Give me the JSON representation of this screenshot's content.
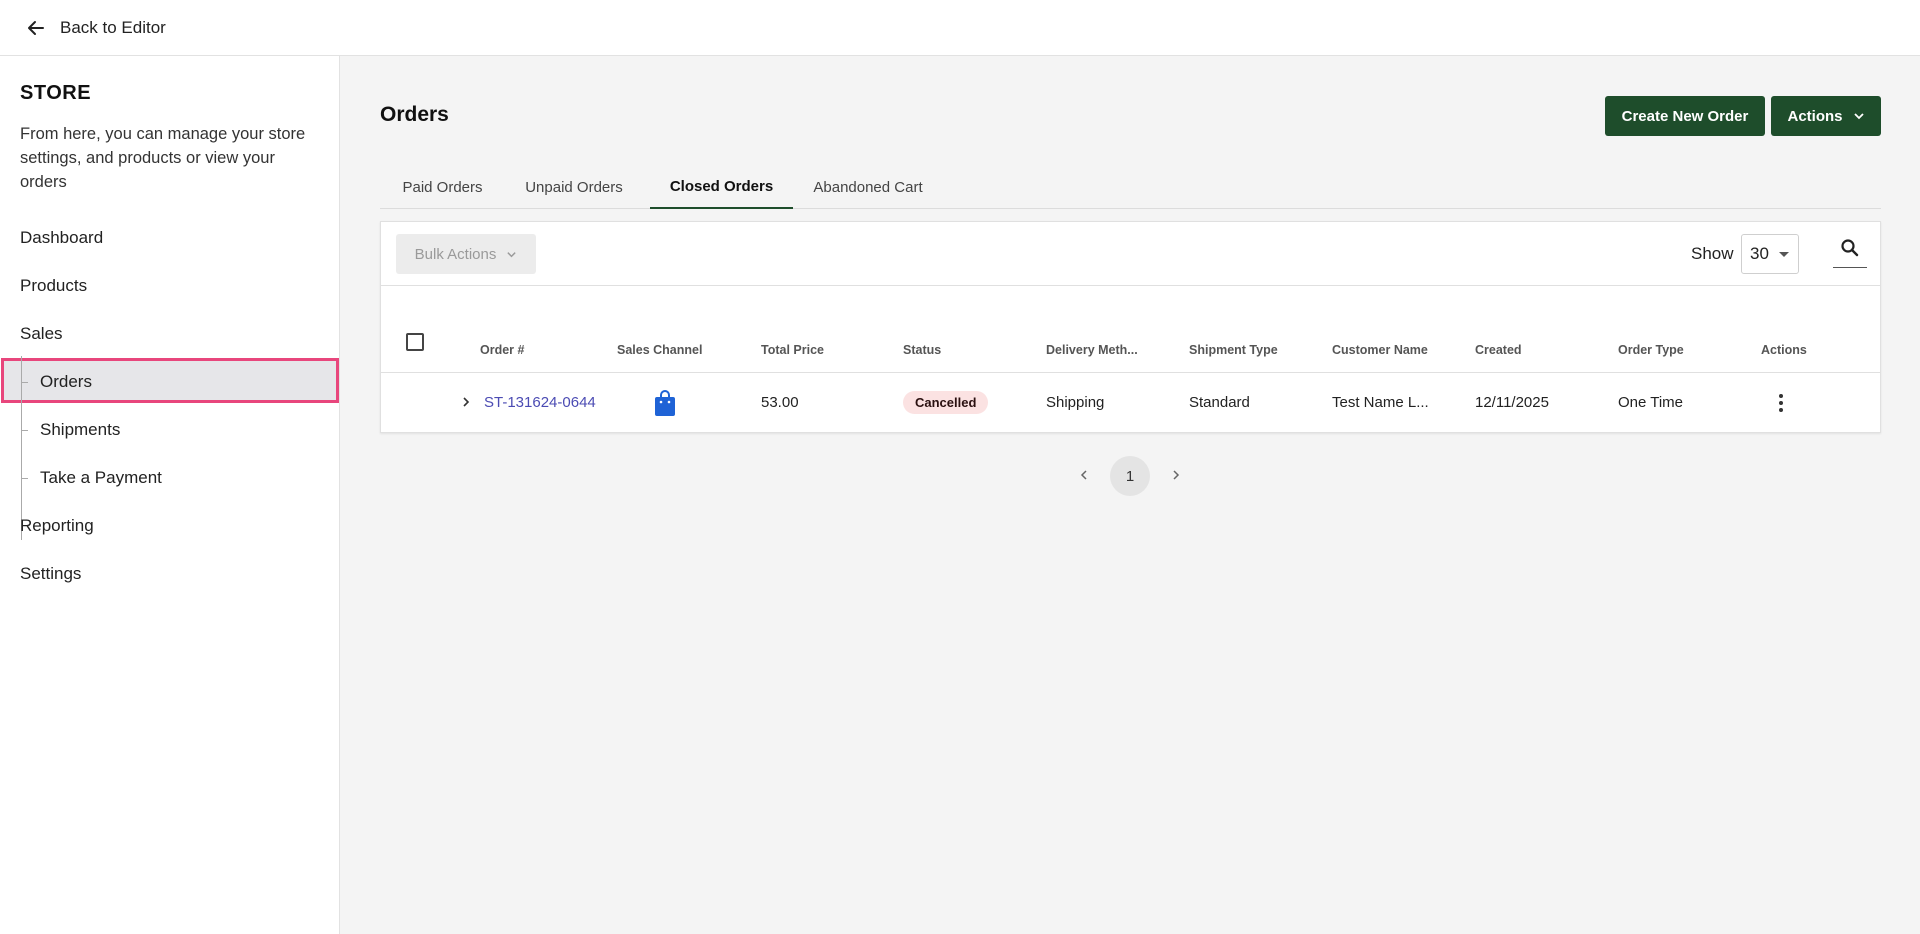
{
  "topbar": {
    "back_label": "Back to Editor"
  },
  "sidebar": {
    "title": "STORE",
    "description": "From here, you can manage your store settings, and products or view your orders",
    "nav": {
      "dashboard": "Dashboard",
      "products": "Products",
      "sales": "Sales",
      "orders": "Orders",
      "shipments": "Shipments",
      "take_payment": "Take a Payment",
      "reporting": "Reporting",
      "settings": "Settings"
    },
    "active_item": "Orders",
    "highlight_color": "#e8467c"
  },
  "main": {
    "title": "Orders",
    "create_button": "Create New Order",
    "actions_button": "Actions",
    "accent_color": "#1e4d2b",
    "tabs": [
      "Paid Orders",
      "Unpaid Orders",
      "Closed Orders",
      "Abandoned Cart"
    ],
    "active_tab": "Closed Orders"
  },
  "toolbar": {
    "bulk_actions": "Bulk Actions",
    "show_label": "Show",
    "page_size": "30",
    "search_icon": "search-icon"
  },
  "table": {
    "headers": [
      "Order #",
      "Sales Channel",
      "Total Price",
      "Status",
      "Delivery Meth...",
      "Shipment Type",
      "Customer Name",
      "Created",
      "Order Type",
      "Actions"
    ],
    "rows": [
      {
        "order_number": "ST-131624-0644",
        "sales_channel_icon": "shopping-bag-icon",
        "total_price": "53.00",
        "status": "Cancelled",
        "delivery_method": "Shipping",
        "shipment_type": "Standard",
        "customer_name": "Test Name L...",
        "created": "12/11/2025",
        "order_type": "One Time"
      }
    ]
  },
  "pagination": {
    "current_page": "1"
  }
}
